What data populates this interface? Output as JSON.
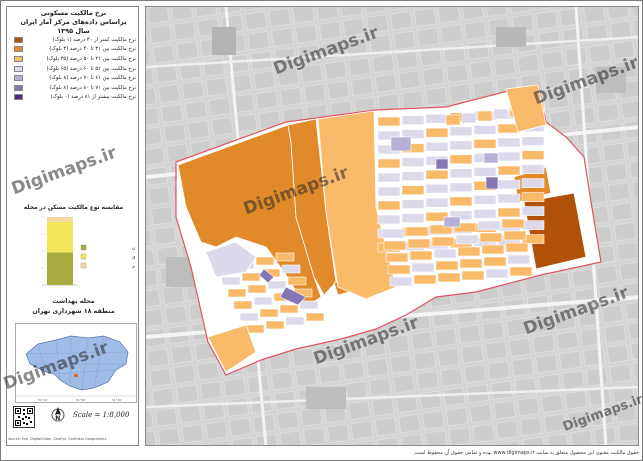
{
  "legend": {
    "title_line1": "نرخ مالکیت مسکونی",
    "title_line2": "براساس داده‌های مرکز آمار ایران",
    "title_line3": "سال ۱۳۹۵",
    "items": [
      {
        "label": "نرخ مالکیت کمتر از ۳۰ درصد (۱ بلوک)",
        "color": "#b2520a"
      },
      {
        "label": "نرخ مالکیت بین ۳۱ تا ۴۰ درصد (۴ بلوک)",
        "color": "#e08a2a"
      },
      {
        "label": "نرخ مالکیت بین ۴۱ تا ۵۰ درصد (۳۵ بلوک)",
        "color": "#f9ba6a"
      },
      {
        "label": "نرخ مالکیت بین ۵۱ تا ۶۰ درصد (۶۵ بلوک)",
        "color": "#dcdaea"
      },
      {
        "label": "نرخ مالکیت بین ۶۱ تا ۷۰ درصد (۸ بلوک)",
        "color": "#b6b0d6"
      },
      {
        "label": "نرخ مالکیت بین ۷۱ تا ۸۰ درصد (۸ بلوک)",
        "color": "#8676b4"
      },
      {
        "label": "نرخ مالکیت بیشتر از ۸۱ درصد (۰ بلوک)",
        "color": "#4f2b80"
      }
    ]
  },
  "chart": {
    "title": "مقایسه نوع مالکیت مسکن در محله",
    "legend_items": [
      {
        "label": "ملکی عرصه و اعیان",
        "color": "#a8ac3c"
      },
      {
        "label": "رهن، استیجاری",
        "color": "#f2e65a"
      },
      {
        "label": "سایر",
        "color": "#f7d9a0"
      }
    ]
  },
  "chart_data": {
    "type": "bar",
    "categories": [
      "محله"
    ],
    "series": [
      {
        "name": "ملکی عرصه و اعیان",
        "values": [
          48
        ]
      },
      {
        "name": "رهن، استیجاری",
        "values": [
          45
        ]
      },
      {
        "name": "سایر",
        "values": [
          7
        ]
      }
    ],
    "stacked": true,
    "ylim": [
      0,
      100
    ]
  },
  "region": {
    "name": "محله بهداشت",
    "district": "منطقه ۱۸ شهرداری تهران"
  },
  "scale": "Scale = 1:8,000",
  "watermark": "Digimaps.ir",
  "footer": "حقوق مالکیت معنوی این محصول متعلق به سایت www.digimaps.ir بوده و تمامی حقوق آن محفوظ است.",
  "credit": "Source: Esri, DigitalGlobe, GeoEye, Earthstar Geographics"
}
